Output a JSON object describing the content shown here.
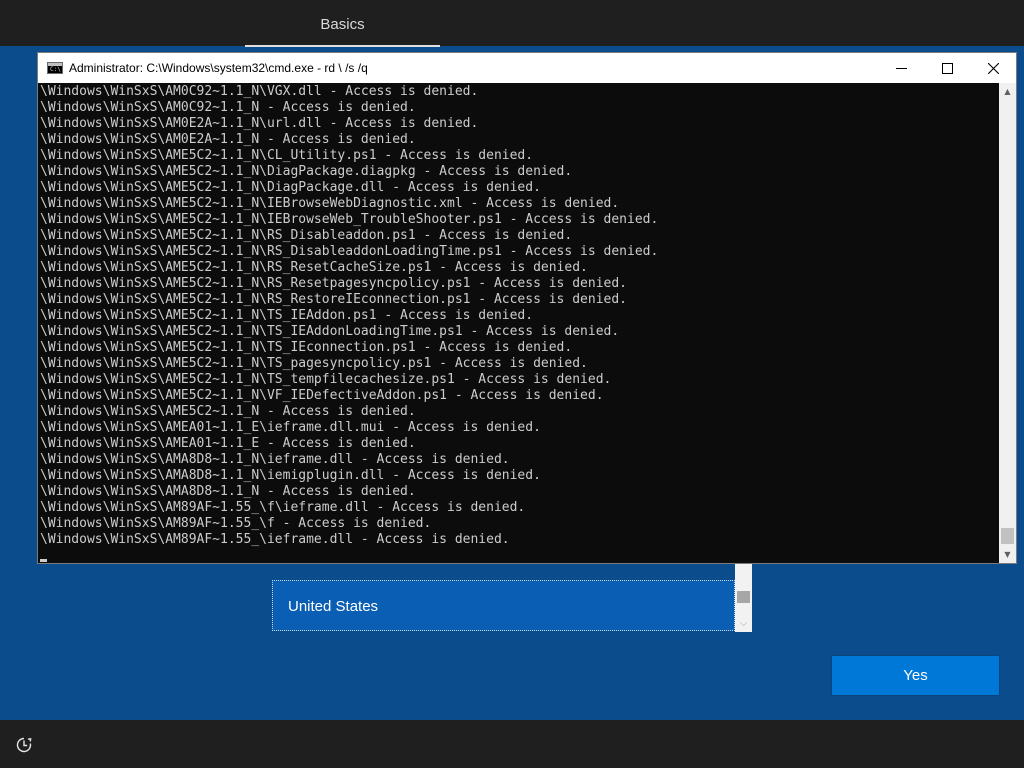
{
  "oobe": {
    "tab_label": "Basics",
    "region_selected": "United States",
    "yes_label": "Yes"
  },
  "cmd": {
    "title": "Administrator: C:\\Windows\\system32\\cmd.exe - rd \\ /s /q",
    "lines": [
      "\\Windows\\WinSxS\\AM0C92~1.1_N\\VGX.dll - Access is denied.",
      "\\Windows\\WinSxS\\AM0C92~1.1_N - Access is denied.",
      "\\Windows\\WinSxS\\AM0E2A~1.1_N\\url.dll - Access is denied.",
      "\\Windows\\WinSxS\\AM0E2A~1.1_N - Access is denied.",
      "\\Windows\\WinSxS\\AME5C2~1.1_N\\CL_Utility.ps1 - Access is denied.",
      "\\Windows\\WinSxS\\AME5C2~1.1_N\\DiagPackage.diagpkg - Access is denied.",
      "\\Windows\\WinSxS\\AME5C2~1.1_N\\DiagPackage.dll - Access is denied.",
      "\\Windows\\WinSxS\\AME5C2~1.1_N\\IEBrowseWebDiagnostic.xml - Access is denied.",
      "\\Windows\\WinSxS\\AME5C2~1.1_N\\IEBrowseWeb_TroubleShooter.ps1 - Access is denied.",
      "\\Windows\\WinSxS\\AME5C2~1.1_N\\RS_Disableaddon.ps1 - Access is denied.",
      "\\Windows\\WinSxS\\AME5C2~1.1_N\\RS_DisableaddonLoadingTime.ps1 - Access is denied.",
      "\\Windows\\WinSxS\\AME5C2~1.1_N\\RS_ResetCacheSize.ps1 - Access is denied.",
      "\\Windows\\WinSxS\\AME5C2~1.1_N\\RS_Resetpagesyncpolicy.ps1 - Access is denied.",
      "\\Windows\\WinSxS\\AME5C2~1.1_N\\RS_RestoreIEconnection.ps1 - Access is denied.",
      "\\Windows\\WinSxS\\AME5C2~1.1_N\\TS_IEAddon.ps1 - Access is denied.",
      "\\Windows\\WinSxS\\AME5C2~1.1_N\\TS_IEAddonLoadingTime.ps1 - Access is denied.",
      "\\Windows\\WinSxS\\AME5C2~1.1_N\\TS_IEconnection.ps1 - Access is denied.",
      "\\Windows\\WinSxS\\AME5C2~1.1_N\\TS_pagesyncpolicy.ps1 - Access is denied.",
      "\\Windows\\WinSxS\\AME5C2~1.1_N\\TS_tempfilecachesize.ps1 - Access is denied.",
      "\\Windows\\WinSxS\\AME5C2~1.1_N\\VF_IEDefectiveAddon.ps1 - Access is denied.",
      "\\Windows\\WinSxS\\AME5C2~1.1_N - Access is denied.",
      "\\Windows\\WinSxS\\AMEA01~1.1_E\\ieframe.dll.mui - Access is denied.",
      "\\Windows\\WinSxS\\AMEA01~1.1_E - Access is denied.",
      "\\Windows\\WinSxS\\AMA8D8~1.1_N\\ieframe.dll - Access is denied.",
      "\\Windows\\WinSxS\\AMA8D8~1.1_N\\iemigplugin.dll - Access is denied.",
      "\\Windows\\WinSxS\\AMA8D8~1.1_N - Access is denied.",
      "\\Windows\\WinSxS\\AM89AF~1.55_\\f\\ieframe.dll - Access is denied.",
      "\\Windows\\WinSxS\\AM89AF~1.55_\\f - Access is denied.",
      "\\Windows\\WinSxS\\AM89AF~1.55_\\ieframe.dll - Access is denied."
    ]
  },
  "icons": {
    "cmd": "command-prompt-icon",
    "minimize": "minimize-icon",
    "maximize": "maximize-icon",
    "close": "close-icon",
    "accessibility": "ease-of-access-icon"
  }
}
